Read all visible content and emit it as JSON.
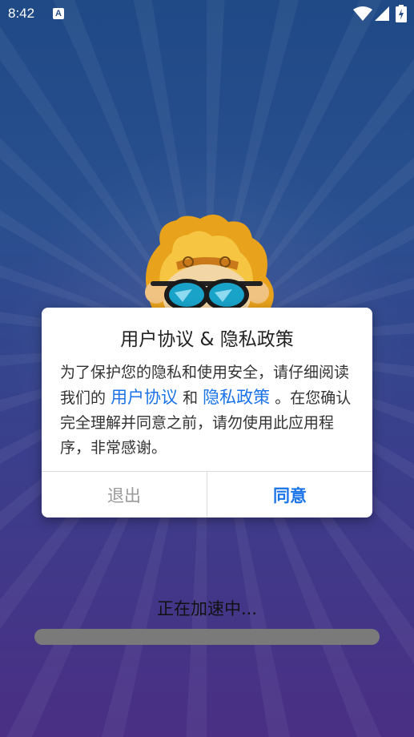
{
  "status_bar": {
    "time": "8:42",
    "notification_icon": "A",
    "icons": [
      "wifi-icon",
      "signal-icon",
      "battery-icon"
    ]
  },
  "dialog": {
    "title": "用户协议 & 隐私政策",
    "body_part1": "为了保护您的隐私和使用安全，请仔细阅读我们的",
    "link_user_agreement": "用户协议",
    "body_and": "和",
    "link_privacy_policy": "隐私政策",
    "body_part2": "。在您确认完全理解并同意之前，请勿使用此应用程序，非常感谢。",
    "exit_button": "退出",
    "agree_button": "同意",
    "colors": {
      "link": "#1a73e8",
      "exit": "#9a9a9a"
    }
  },
  "loading": {
    "text": "正在加速中...",
    "progress": 0
  },
  "theme": {
    "background_top": "#1f4a86",
    "background_bottom": "#4a2f84"
  }
}
